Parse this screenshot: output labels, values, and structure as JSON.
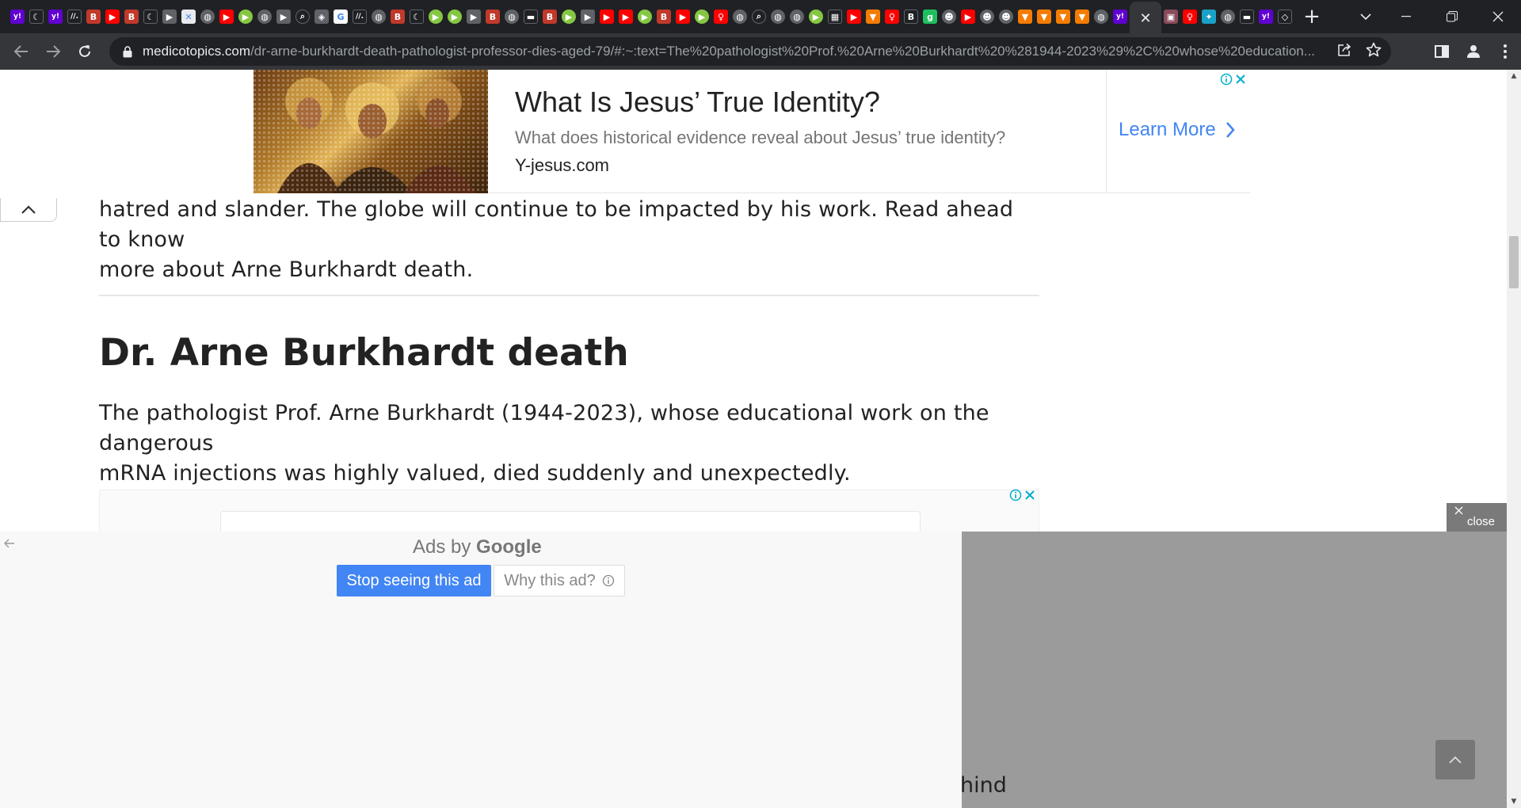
{
  "browser": {
    "active_tab_close": "✕",
    "new_tab": "+",
    "tab_favicons": [
      {
        "name": "yahoo",
        "glyph": "y!",
        "color": "#6001d2"
      },
      {
        "name": "crescent",
        "glyph": "☾",
        "color": "#202124"
      },
      {
        "name": "yahoo",
        "glyph": "y!",
        "color": "#6001d2"
      },
      {
        "name": "slash",
        "glyph": "//.",
        "color": "#202124"
      },
      {
        "name": "bi",
        "glyph": "B",
        "color": "#c0392b"
      },
      {
        "name": "youtube",
        "glyph": "▶",
        "color": "#ff0000"
      },
      {
        "name": "bi",
        "glyph": "B",
        "color": "#c0392b"
      },
      {
        "name": "crescent",
        "glyph": "☾",
        "color": "#202124"
      },
      {
        "name": "arrow",
        "glyph": "▶",
        "color": "#5f6368"
      },
      {
        "name": "x",
        "glyph": "✕",
        "color": "#e8eaed"
      },
      {
        "name": "globe",
        "glyph": "◍",
        "color": "#5f6368"
      },
      {
        "name": "youtube",
        "glyph": "▶",
        "color": "#ff0000"
      },
      {
        "name": "rumble",
        "glyph": "▶",
        "color": "#85c742"
      },
      {
        "name": "globe",
        "glyph": "◍",
        "color": "#5f6368"
      },
      {
        "name": "arrow",
        "glyph": "▶",
        "color": "#5f6368"
      },
      {
        "name": "search",
        "glyph": "⌕",
        "color": "#202124"
      },
      {
        "name": "shield",
        "glyph": "◈",
        "color": "#5f6368"
      },
      {
        "name": "google",
        "glyph": "G",
        "color": "#ffffff"
      },
      {
        "name": "slash",
        "glyph": "//.",
        "color": "#202124"
      },
      {
        "name": "globe",
        "glyph": "◍",
        "color": "#5f6368"
      },
      {
        "name": "bi",
        "glyph": "B",
        "color": "#c0392b"
      },
      {
        "name": "crescent",
        "glyph": "☾",
        "color": "#202124"
      },
      {
        "name": "rumble",
        "glyph": "▶",
        "color": "#85c742"
      },
      {
        "name": "rumble",
        "glyph": "▶",
        "color": "#85c742"
      },
      {
        "name": "arrow",
        "glyph": "▶",
        "color": "#5f6368"
      },
      {
        "name": "bi",
        "glyph": "B",
        "color": "#c0392b"
      },
      {
        "name": "globe",
        "glyph": "◍",
        "color": "#5f6368"
      },
      {
        "name": "dark",
        "glyph": "▬",
        "color": "#202124"
      },
      {
        "name": "bi",
        "glyph": "B",
        "color": "#c0392b"
      },
      {
        "name": "rumble",
        "glyph": "▶",
        "color": "#85c742"
      },
      {
        "name": "arrow",
        "glyph": "▶",
        "color": "#5f6368"
      },
      {
        "name": "youtube",
        "glyph": "▶",
        "color": "#ff0000"
      },
      {
        "name": "youtube",
        "glyph": "▶",
        "color": "#ff0000"
      },
      {
        "name": "rumble",
        "glyph": "▶",
        "color": "#85c742"
      },
      {
        "name": "bi",
        "glyph": "B",
        "color": "#c0392b"
      },
      {
        "name": "youtube",
        "glyph": "▶",
        "color": "#ff0000"
      },
      {
        "name": "rumble",
        "glyph": "▶",
        "color": "#85c742"
      },
      {
        "name": "figure",
        "glyph": "♀",
        "color": "#ff0000"
      },
      {
        "name": "globe",
        "glyph": "◍",
        "color": "#5f6368"
      },
      {
        "name": "search",
        "glyph": "⌕",
        "color": "#202124"
      },
      {
        "name": "globe",
        "glyph": "◍",
        "color": "#5f6368"
      },
      {
        "name": "globe",
        "glyph": "◍",
        "color": "#5f6368"
      },
      {
        "name": "rumble",
        "glyph": "▶",
        "color": "#85c742"
      },
      {
        "name": "news",
        "glyph": "▦",
        "color": "#202124"
      },
      {
        "name": "youtube",
        "glyph": "▶",
        "color": "#ff0000"
      },
      {
        "name": "bookmark",
        "glyph": "▼",
        "color": "#f57c00"
      },
      {
        "name": "figure",
        "glyph": "♀",
        "color": "#ff0000"
      },
      {
        "name": "bi",
        "glyph": "B",
        "color": "#202124"
      },
      {
        "name": "g",
        "glyph": "g",
        "color": "#1fbf5f"
      },
      {
        "name": "person",
        "glyph": "☻",
        "color": "#5f6368"
      },
      {
        "name": "youtube",
        "glyph": "▶",
        "color": "#ff0000"
      },
      {
        "name": "person",
        "glyph": "☻",
        "color": "#5f6368"
      },
      {
        "name": "person",
        "glyph": "☻",
        "color": "#5f6368"
      },
      {
        "name": "bookmark",
        "glyph": "▼",
        "color": "#f57c00"
      },
      {
        "name": "bookmark",
        "glyph": "▼",
        "color": "#f57c00"
      },
      {
        "name": "bookmark",
        "glyph": "▼",
        "color": "#f57c00"
      },
      {
        "name": "bookmark",
        "glyph": "▼",
        "color": "#f57c00"
      },
      {
        "name": "globe",
        "glyph": "◍",
        "color": "#5f6368"
      },
      {
        "name": "yahoo",
        "glyph": "y!",
        "color": "#6001d2"
      }
    ],
    "tab_favicons_after": [
      {
        "name": "photo",
        "glyph": "▣",
        "color": "#8a4b5c"
      },
      {
        "name": "figure",
        "glyph": "♀",
        "color": "#ff0000"
      },
      {
        "name": "bird",
        "glyph": "✦",
        "color": "#1aa1c7"
      },
      {
        "name": "globe",
        "glyph": "◍",
        "color": "#5f6368"
      },
      {
        "name": "dark",
        "glyph": "▬",
        "color": "#202124"
      },
      {
        "name": "yahoo",
        "glyph": "y!",
        "color": "#6001d2"
      },
      {
        "name": "shield",
        "glyph": "◇",
        "color": "#202124"
      }
    ],
    "url_host": "medicotopics.com",
    "url_path": "/dr-arne-burkhardt-death-pathologist-professor-dies-aged-79/#:~:text=The%20pathologist%20Prof.%20Arne%20Burkhardt%20%281944-2023%29%2C%20whose%20education..."
  },
  "top_ad": {
    "title": "What Is Jesus’ True Identity?",
    "description": "What does historical evidence reveal about Jesus’ true identity?",
    "domain": "Y-jesus.com",
    "cta": "Learn More"
  },
  "article": {
    "para1_line1": "hatred and slander. The globe will continue to be impacted by his work. Read ahead to know",
    "para1_line2": "more about Arne Burkhardt death.",
    "heading": "Dr. Arne Burkhardt death",
    "para2_line1": "The pathologist Prof. Arne Burkhardt (1944-2023), whose educational work on the dangerous",
    "para2_line2": "mRNA injections was highly valued, died suddenly and unexpectedly.",
    "peek_text": "hind"
  },
  "google_ad": {
    "ads_by": "Ads by",
    "brand": "Google",
    "stop_label": "Stop seeing this ad",
    "why_label": "Why this ad?"
  },
  "sticky_ad": {
    "close_label": "close"
  }
}
